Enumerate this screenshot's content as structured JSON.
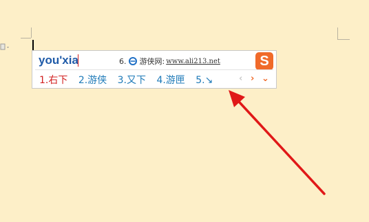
{
  "ime": {
    "pinyin": "you'xia",
    "hint": {
      "number": "6.",
      "icon": "ie-browser-icon",
      "site_name": "游侠网:",
      "url": "www.ali213.net"
    },
    "logo": {
      "letter": "S",
      "color": "#f06a2a"
    },
    "candidates": [
      {
        "label": "1.右下",
        "selected": true
      },
      {
        "label": "2.游侠",
        "selected": false
      },
      {
        "label": "3.又下",
        "selected": false
      },
      {
        "label": "4.游匣",
        "selected": false
      },
      {
        "label": "5.↘",
        "selected": false
      }
    ],
    "nav": {
      "prev": "‹",
      "next": "›",
      "more": "⌄"
    }
  },
  "colors": {
    "document_background": "#fdefc8",
    "selected_candidate": "#d21f1f",
    "candidate": "#1e7ab8",
    "pinyin": "#1e5aa8",
    "annotation_arrow": "#e01818"
  }
}
